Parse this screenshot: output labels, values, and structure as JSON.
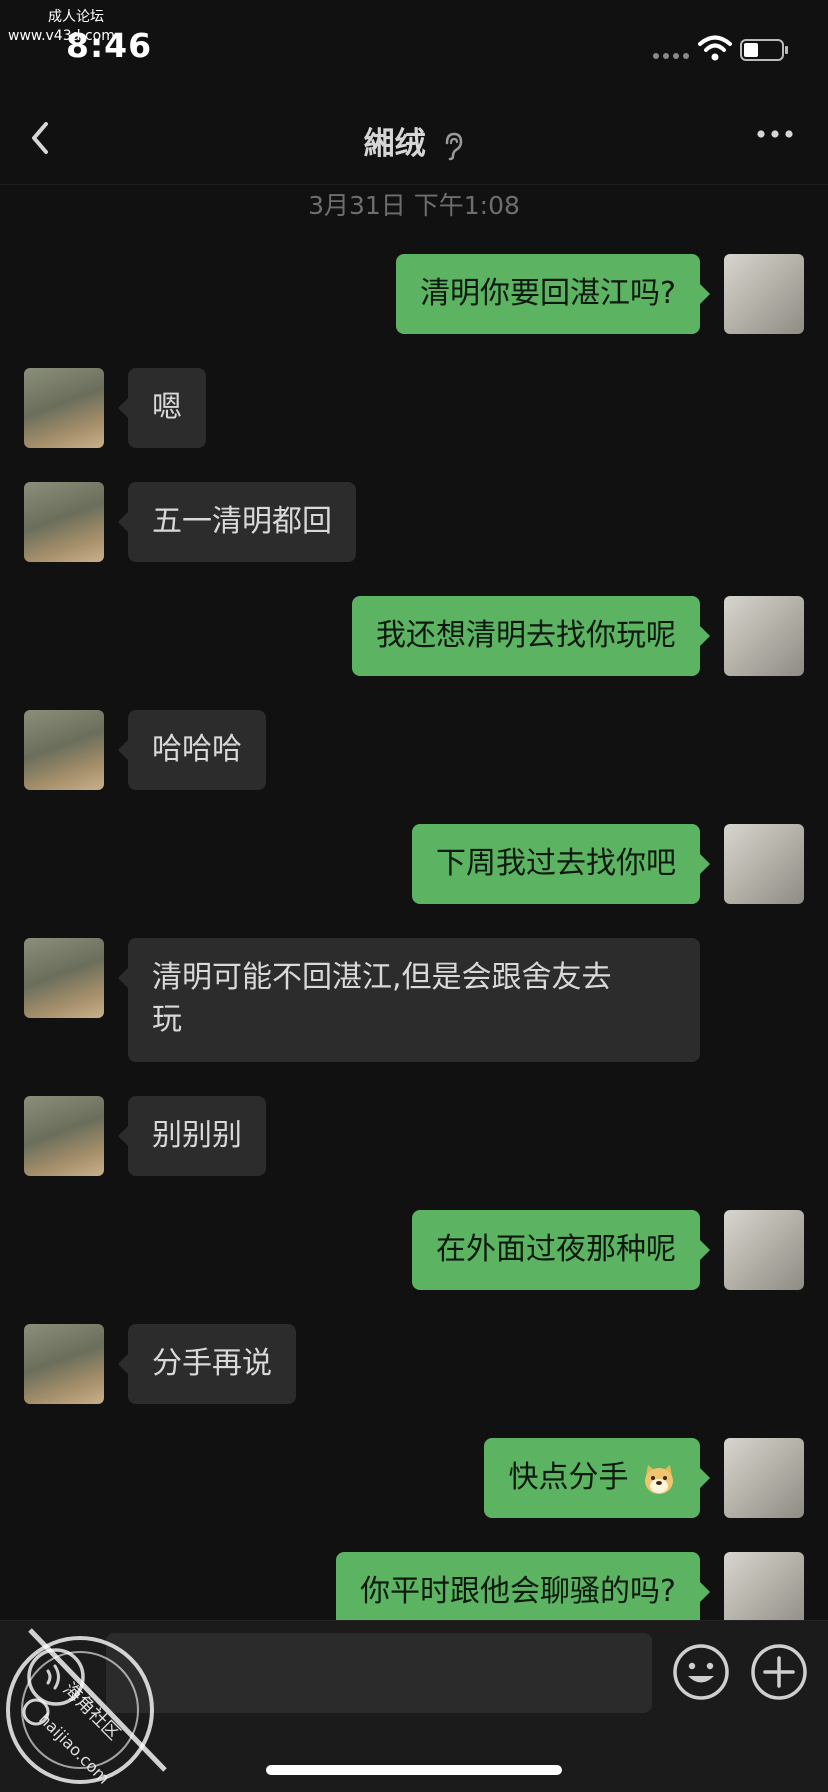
{
  "status_bar": {
    "time": "8:46",
    "watermark_line1": "成人论坛",
    "watermark_line2": "www.v43d.com"
  },
  "nav": {
    "title": "緗绒",
    "back_icon": "chevron-left-icon",
    "more_icon": "more-dots-icon",
    "ear_icon": "ear-icon"
  },
  "timestamp": "3月31日 下午1:08",
  "messages": [
    {
      "side": "right",
      "text": "清明你要回湛江吗?"
    },
    {
      "side": "left",
      "text": "嗯"
    },
    {
      "side": "left",
      "text": "五一清明都回"
    },
    {
      "side": "right",
      "text": "我还想清明去找你玩呢"
    },
    {
      "side": "left",
      "text": "哈哈哈"
    },
    {
      "side": "right",
      "text": "下周我过去找你吧"
    },
    {
      "side": "left",
      "text": "清明可能不回湛江,但是会跟舍友去\n玩"
    },
    {
      "side": "left",
      "text": "别别别"
    },
    {
      "side": "right",
      "text": "在外面过夜那种呢"
    },
    {
      "side": "left",
      "text": "分手再说"
    },
    {
      "side": "right",
      "text": "快点分手",
      "emoji": "doge-emoji"
    },
    {
      "side": "right",
      "text": "你平时跟他会聊骚的吗?"
    }
  ],
  "input": {
    "value": "",
    "placeholder": ""
  },
  "watermark_stamp": {
    "line1": "海角社区",
    "line2": "haijiao.com"
  },
  "colors": {
    "background": "#111111",
    "bubble_self": "#5cb362",
    "bubble_other": "#2c2c2c",
    "text_light": "#d9d9d9"
  }
}
